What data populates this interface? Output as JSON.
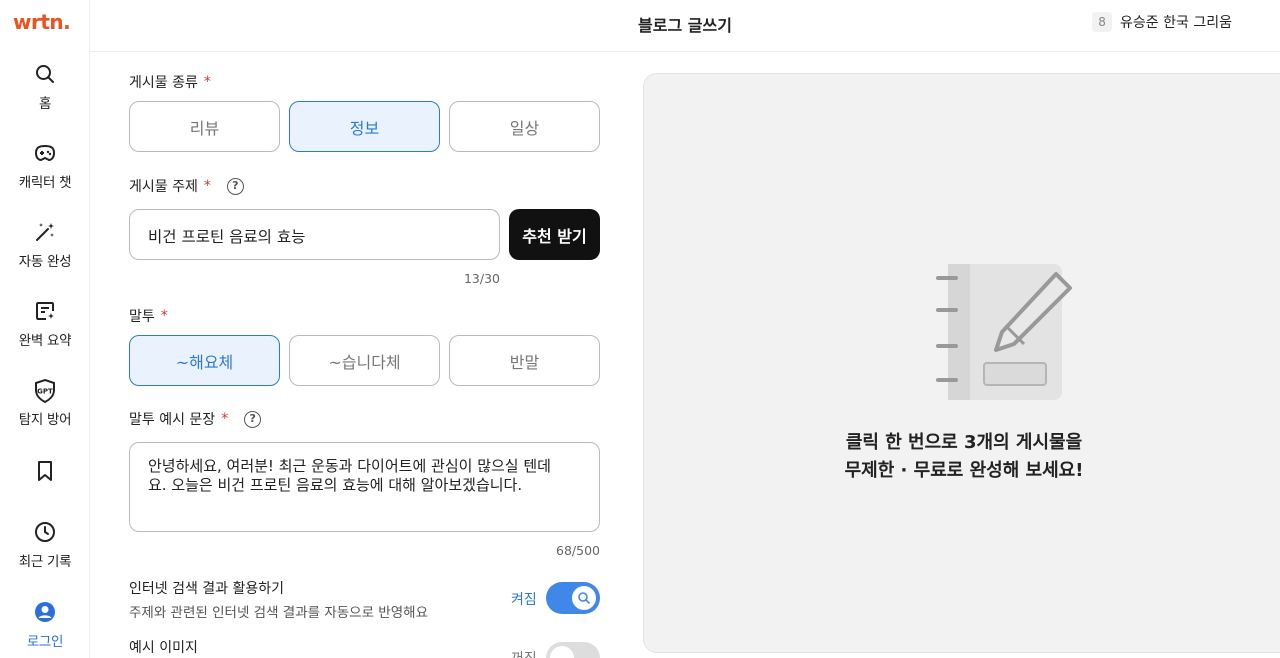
{
  "app": {
    "logo": "wrtn.",
    "title": "블로그 글쓰기"
  },
  "header": {
    "badge_count": "8",
    "user_name": "유승준 한국 그리움"
  },
  "sidebar": {
    "items": [
      {
        "label": "홈",
        "icon": "search-icon"
      },
      {
        "label": "캐릭터 챗",
        "icon": "gamepad-icon"
      },
      {
        "label": "자동 완성",
        "icon": "magic-wand-icon"
      },
      {
        "label": "완벽 요약",
        "icon": "summary-doc-icon"
      },
      {
        "label": "탐지 방어",
        "icon": "gpt-shield-icon"
      },
      {
        "label": "",
        "icon": "bookmark-icon"
      },
      {
        "label": "최근 기록",
        "icon": "clock-icon"
      },
      {
        "label": "로그인",
        "icon": "user-circle-icon"
      }
    ]
  },
  "form": {
    "post_type": {
      "label": "게시물 종류",
      "required_mark": "*",
      "options": [
        "리뷰",
        "정보",
        "일상"
      ],
      "selected": "정보"
    },
    "topic": {
      "label": "게시물 주제",
      "required_mark": "*",
      "help": "?",
      "value": "비건 프로틴 음료의 효능",
      "recommend_button": "추천 받기",
      "counter": "13/30"
    },
    "tone": {
      "label": "말투",
      "required_mark": "*",
      "options": [
        "~해요체",
        "~습니다체",
        "반말"
      ],
      "selected": "~해요체"
    },
    "tone_example": {
      "label": "말투 예시 문장",
      "required_mark": "*",
      "help": "?",
      "line1": "안녕하세요, 여러분! 최근 운동과 다이어트에 관심이 많으실 텐데",
      "line2": "요. 오늘은 비건 프로틴 음료의 효능에 대해 알아보겠습니다.",
      "counter": "68/500"
    },
    "internet_search": {
      "title": "인터넷 검색 결과 활용하기",
      "description": "주제와 관련된 인터넷 검색 결과를 자동으로 반영해요",
      "state_label": "켜짐",
      "enabled": true
    },
    "example_image": {
      "title": "예시 이미지",
      "state_label": "꺼짐",
      "enabled": false
    }
  },
  "preview": {
    "icon": "notebook-pencil-icon",
    "line1": "클릭 한 번으로 3개의 게시물을",
    "line2": "무제한 · 무료로 완성해 보세요!"
  },
  "colors": {
    "brand": "#e8531f",
    "accent": "#2b7ad8",
    "required": "#e0312b"
  }
}
